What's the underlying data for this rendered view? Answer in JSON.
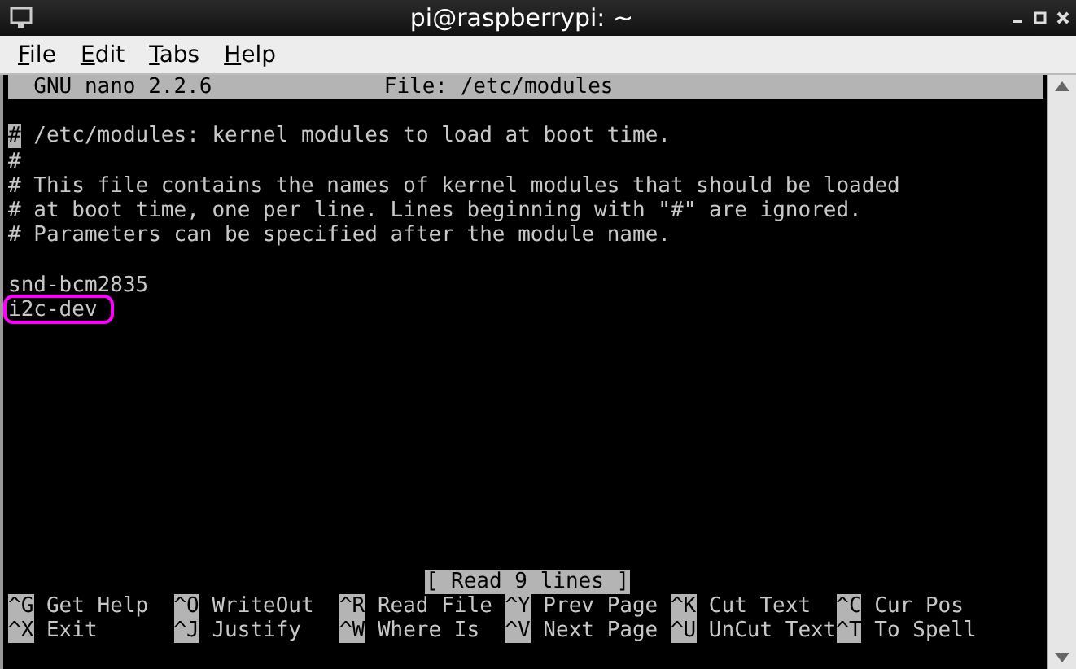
{
  "window": {
    "title": "pi@raspberrypi: ~"
  },
  "menu": [
    "File",
    "Edit",
    "Tabs",
    "Help"
  ],
  "nano": {
    "version": "GNU nano 2.2.6",
    "file": "File: /etc/modules",
    "blocks": [
      {
        "lines": [
          {
            "text": "# /etc/modules: kernel modules to load at boot time.",
            "cursor": true,
            "circled": false
          },
          {
            "text": "#",
            "cursor": false,
            "circled": false
          },
          {
            "text": "# This file contains the names of kernel modules that should be loaded",
            "cursor": false,
            "circled": false
          },
          {
            "text": "# at boot time, one per line. Lines beginning with \"#\" are ignored.",
            "cursor": false,
            "circled": false
          },
          {
            "text": "# Parameters can be specified after the module name.",
            "cursor": false,
            "circled": false
          }
        ]
      },
      {
        "lines": [
          {
            "text": "snd-bcm2835",
            "cursor": false,
            "circled": false
          },
          {
            "text": "i2c-dev",
            "cursor": false,
            "circled": true
          }
        ]
      }
    ],
    "status": "[ Read 9 lines ]",
    "shortcuts": [
      {
        "key": "^G",
        "label": "Get Help"
      },
      {
        "key": "^O",
        "label": "WriteOut"
      },
      {
        "key": "^R",
        "label": "Read File"
      },
      {
        "key": "^Y",
        "label": "Prev Page"
      },
      {
        "key": "^K",
        "label": "Cut Text"
      },
      {
        "key": "^C",
        "label": "Cur Pos"
      },
      {
        "key": "^X",
        "label": "Exit"
      },
      {
        "key": "^J",
        "label": "Justify"
      },
      {
        "key": "^W",
        "label": "Where Is"
      },
      {
        "key": "^V",
        "label": "Next Page"
      },
      {
        "key": "^U",
        "label": "UnCut Text"
      },
      {
        "key": "^T",
        "label": "To Spell"
      }
    ]
  }
}
